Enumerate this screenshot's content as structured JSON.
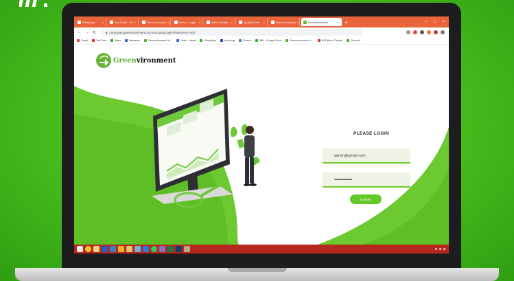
{
  "browser": {
    "tabs": [
      "WhatsApp",
      "Job Portal - Sit",
      "Greenvironment",
      "Home - Login",
      "Sales Monitor",
      "Quality Rules",
      "Greenvironment",
      "Greenvironment"
    ],
    "active_tab": "Greenvironment",
    "url": "corporate.greenvironment.co.in/Account/Login?ReturnUrl=%2F",
    "bookmarks": [
      "Gmail",
      "YouTube",
      "Maps",
      "Netvance",
      "Greenvironment In...",
      "Hotel - Latest",
      "WhatsApp",
      "Invoicing",
      "Freeze",
      "IBM - Google Drive",
      "Greenvironment In...",
      "Mi Python Tutorial",
      "Greenvi"
    ]
  },
  "page": {
    "brand_prefix": "Green",
    "brand_suffix": "vironment",
    "login_title": "PLEASE LOGIN",
    "email_value": "admin@gmail.com",
    "password_value": "••••••••••••••••••",
    "submit_label": "SUBMIT"
  },
  "colors": {
    "accent": "#63c926",
    "brand_green": "#5fae2e",
    "background_green": "#4cc21f",
    "tabbar": "#e9643a",
    "taskbar": "#b5271f"
  },
  "taskbar_icons": [
    "windows-start-icon",
    "chrome-icon",
    "file-explorer-icon",
    "word-icon",
    "app-icon",
    "sketch-icon",
    "folder-icon",
    "image-icon",
    "vscode-icon",
    "whatsapp-icon",
    "app-icon",
    "excel-icon",
    "photoshop-icon",
    "app-icon"
  ]
}
